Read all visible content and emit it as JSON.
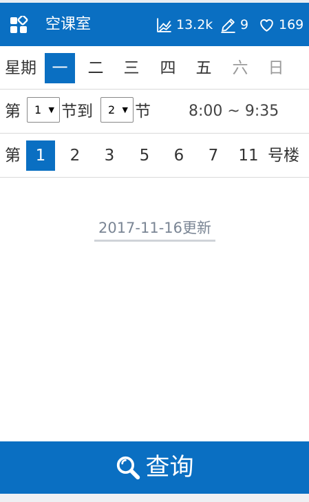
{
  "header": {
    "title": "空课室",
    "views": "13.2k",
    "edits": "9",
    "likes": "169",
    "icons": {
      "app": "apps-grid-icon",
      "views": "chart-line-icon",
      "edits": "pencil-icon",
      "likes": "heart-icon"
    },
    "colors": {
      "brand": "#0a6fc2",
      "text": "#ffffff"
    }
  },
  "weekday": {
    "label": "星期",
    "days": [
      {
        "label": "一",
        "state": "active"
      },
      {
        "label": "二",
        "state": "normal"
      },
      {
        "label": "三",
        "state": "normal"
      },
      {
        "label": "四",
        "state": "normal"
      },
      {
        "label": "五",
        "state": "normal"
      },
      {
        "label": "六",
        "state": "disabled"
      },
      {
        "label": "日",
        "state": "disabled"
      }
    ]
  },
  "period": {
    "prefix": "第",
    "from_value": "1",
    "middle": "节到",
    "to_value": "2",
    "suffix": "节",
    "time_range": "8:00 ~ 9:35"
  },
  "building": {
    "prefix": "第",
    "numbers": [
      {
        "label": "1",
        "state": "active"
      },
      {
        "label": "2",
        "state": "normal"
      },
      {
        "label": "3",
        "state": "normal"
      },
      {
        "label": "5",
        "state": "normal"
      },
      {
        "label": "6",
        "state": "normal"
      },
      {
        "label": "7",
        "state": "normal"
      },
      {
        "label": "11",
        "state": "normal"
      }
    ],
    "suffix": "号楼"
  },
  "updated_text": "2017-11-16更新",
  "query": {
    "label": "查询",
    "icon": "search-icon"
  }
}
